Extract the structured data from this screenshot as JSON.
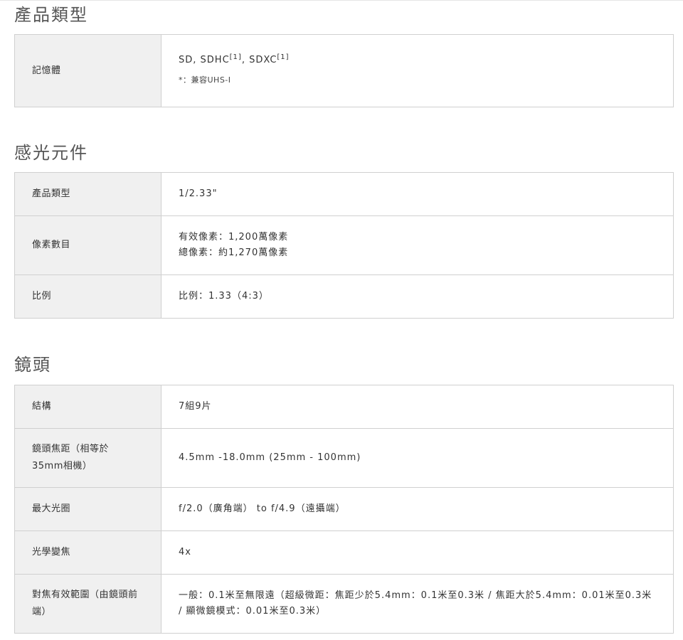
{
  "sections": [
    {
      "title": "產品類型",
      "rows": [
        {
          "label": "記憶體",
          "value_parts": [
            "SD, SDHC",
            "[1]",
            ", SDXC",
            "[1]"
          ],
          "note": "*：兼容UHS-I"
        }
      ]
    },
    {
      "title": "感光元件",
      "rows": [
        {
          "label": "產品類型",
          "value": "1/2.33\""
        },
        {
          "label": "像素數目",
          "lines": [
            "有效像素：1,200萬像素",
            "總像素：約1,270萬像素"
          ]
        },
        {
          "label": "比例",
          "value": "比例：1.33（4:3）"
        }
      ]
    },
    {
      "title": "鏡頭",
      "rows": [
        {
          "label": "結構",
          "value": "7組9片"
        },
        {
          "label": "鏡頭焦距（相等於35mm相機）",
          "value": "4.5mm -18.0mm (25mm - 100mm)"
        },
        {
          "label": "最大光圈",
          "value": "f/2.0（廣角端） to f/4.9（遠攝端）"
        },
        {
          "label": "光學變焦",
          "value": "4x"
        },
        {
          "label": "對焦有效範圍（由鏡頭前端）",
          "value": "一般：0.1米至無限遠（超級微距：焦距少於5.4mm：0.1米至0.3米 / 焦距大於5.4mm：0.01米至0.3米 / 顯微鏡模式：0.01米至0.3米）"
        }
      ]
    }
  ]
}
